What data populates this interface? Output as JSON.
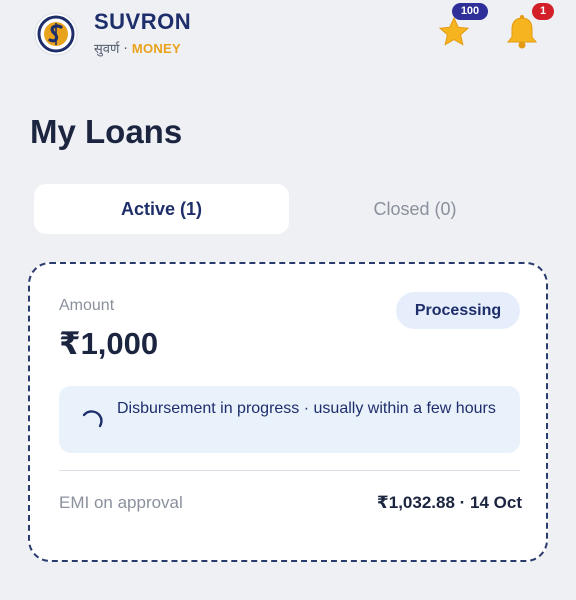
{
  "header": {
    "brand_name": "SUVRON",
    "brand_sub_hindi": "सुवर्ण ·",
    "brand_sub_money": "MONEY",
    "star_icon": "star-icon",
    "star_badge": "100",
    "bell_icon": "bell-icon",
    "bell_badge": "1"
  },
  "page": {
    "title": "My Loans"
  },
  "tabs": [
    {
      "label": "Active (1)",
      "active": true
    },
    {
      "label": "Closed (0)",
      "active": false
    }
  ],
  "loan_card": {
    "amount_label": "Amount",
    "amount_value": "₹1,000",
    "status": "Processing",
    "info_icon": "spinner-icon",
    "info_text": "Disbursement in progress · usually within a few hours",
    "emi_label": "EMI on approval",
    "emi_value": "₹1,032.88 · 14 Oct"
  },
  "colors": {
    "background": "#eef0f4",
    "brand_navy": "#1e2e6b",
    "money_gold": "#e9a21b",
    "star_badge": "#2f2f9a",
    "bell_badge": "#d32028",
    "info_box": "#e9f1fb"
  }
}
